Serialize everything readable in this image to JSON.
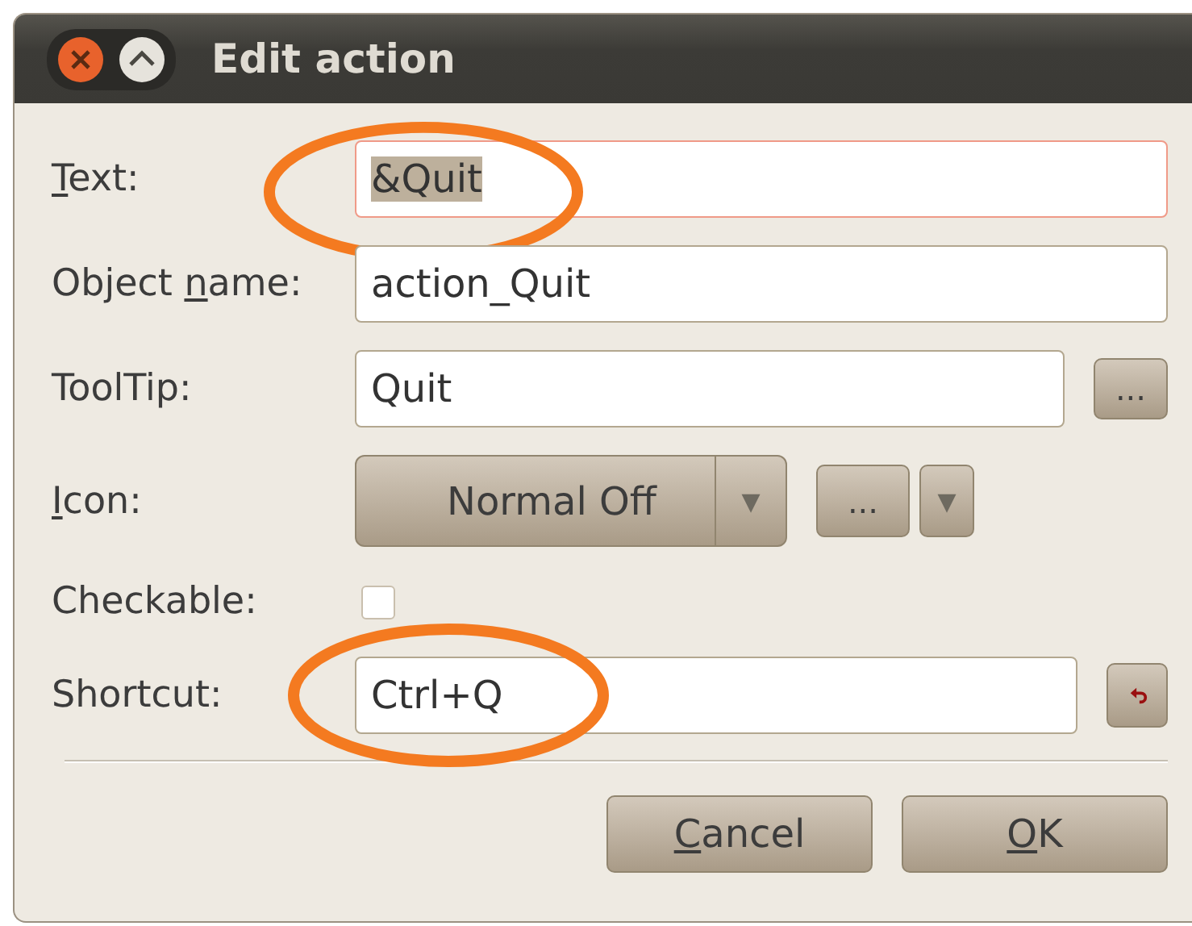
{
  "window": {
    "title": "Edit action"
  },
  "rows": [
    {
      "kind": "text",
      "label": [
        {
          "text": "T",
          "underlined": true
        },
        {
          "text": "ext:",
          "underlined": false
        }
      ],
      "value": "&Quit",
      "focused": true,
      "text_selected": true,
      "circled": true
    },
    {
      "kind": "text",
      "label": [
        {
          "text": "Object ",
          "underlined": false
        },
        {
          "text": "n",
          "underlined": true
        },
        {
          "text": "ame:",
          "underlined": false
        }
      ],
      "value": "action_Quit",
      "focused": false,
      "text_selected": false,
      "circled": false
    },
    {
      "kind": "text_button",
      "label": [
        {
          "text": "ToolTip:",
          "underlined": false
        }
      ],
      "value": "Quit",
      "button": "..."
    },
    {
      "kind": "icon",
      "label": [
        {
          "text": "I",
          "underlined": true
        },
        {
          "text": "con:",
          "underlined": false
        }
      ],
      "combo": "Normal Off",
      "combo_arrow": "▼",
      "button": "...",
      "arrow": "▼"
    },
    {
      "kind": "checkbox",
      "label": [
        {
          "text": "Checkable:",
          "underlined": false
        }
      ],
      "checked": false
    },
    {
      "kind": "shortcut",
      "label": [
        {
          "text": "Shortcut:",
          "underlined": false
        }
      ],
      "value": "Ctrl+Q",
      "circled": true
    }
  ],
  "buttons": [
    {
      "label": [
        {
          "text": "C",
          "underlined": true
        },
        {
          "text": "ancel",
          "underlined": false
        }
      ]
    },
    {
      "label": [
        {
          "text": "O",
          "underlined": true
        },
        {
          "text": "K",
          "underlined": false
        }
      ]
    }
  ]
}
